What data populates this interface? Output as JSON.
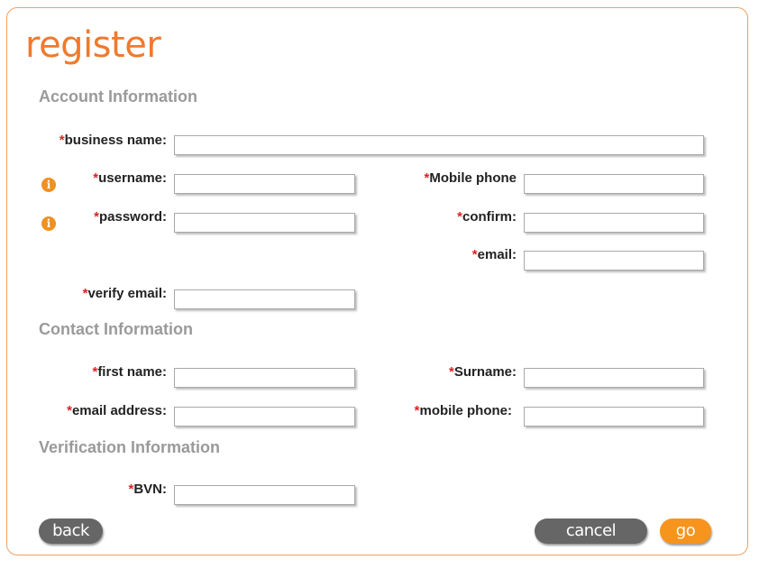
{
  "page": {
    "title": "register"
  },
  "sections": {
    "account": "Account Information",
    "contact": "Contact Information",
    "verification": "Verification Information"
  },
  "required_marker": "*",
  "fields": {
    "business_name": {
      "label": "business name:",
      "value": ""
    },
    "username": {
      "label": "username:",
      "value": ""
    },
    "password": {
      "label": "password:",
      "value": ""
    },
    "mobile_phone_account": {
      "label": "Mobile phone",
      "value": ""
    },
    "confirm": {
      "label": "confirm:",
      "value": ""
    },
    "email": {
      "label": "email:",
      "value": ""
    },
    "verify_email": {
      "label": "verify email:",
      "value": ""
    },
    "first_name": {
      "label": "first name:",
      "value": ""
    },
    "surname": {
      "label": "Surname:",
      "value": ""
    },
    "email_address": {
      "label": "email address:",
      "value": ""
    },
    "mobile_phone_contact": {
      "label": "mobile phone:",
      "value": ""
    },
    "bvn": {
      "label": "BVN:",
      "value": ""
    }
  },
  "info_icon_glyph": "i",
  "buttons": {
    "back": "back",
    "cancel": "cancel",
    "go": "go"
  },
  "colors": {
    "accent": "#f07a2d",
    "go_button": "#f7941d",
    "gray_button": "#666666",
    "section": "#9a9a9a"
  }
}
